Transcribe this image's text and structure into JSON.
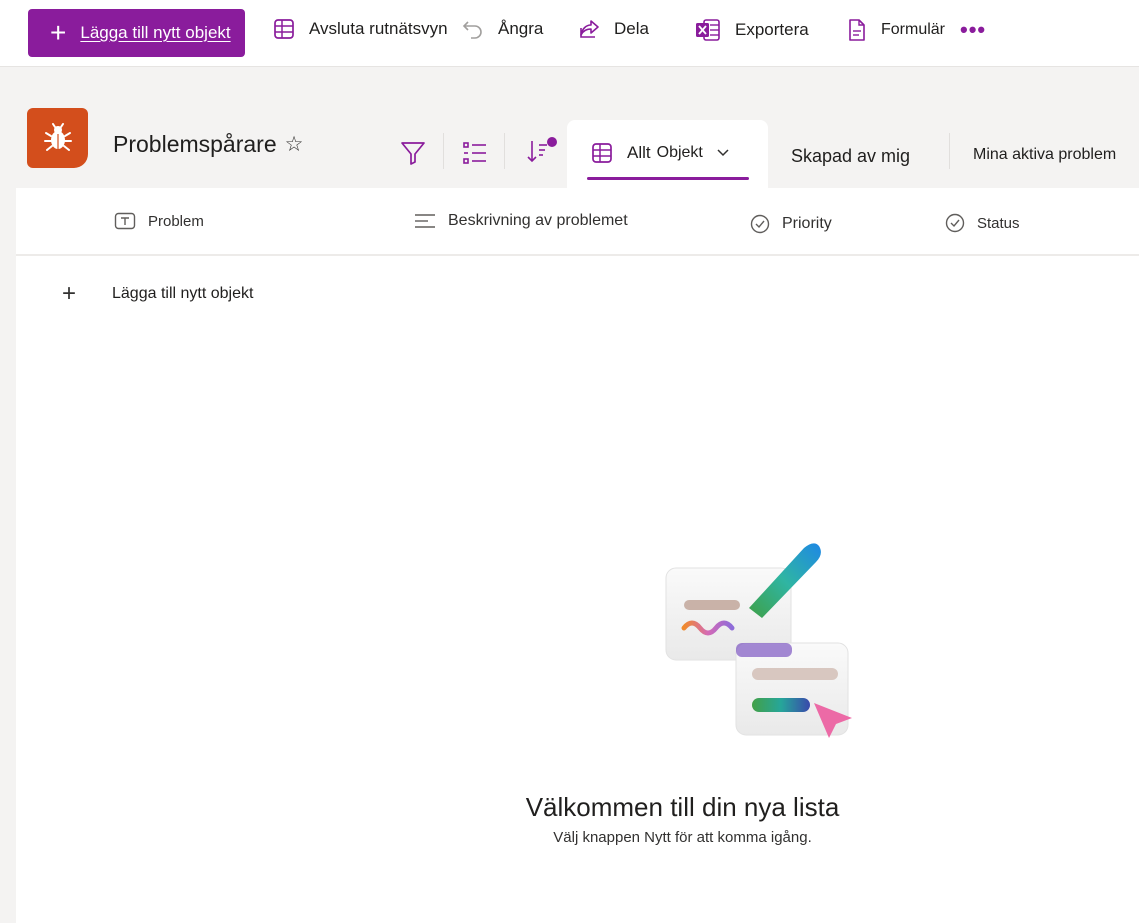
{
  "commandbar": {
    "new_label": "Lägga till nytt objekt",
    "grid_label": "Avsluta rutnätsvyn",
    "undo_label": "Ångra",
    "share_label": "Dela",
    "export_label": "Exportera",
    "forms_label": "Formulär",
    "more_label": "•••"
  },
  "header": {
    "list_title": "Problemspårare",
    "views": {
      "active_view_label": "Allt",
      "active_view_suffix": "Objekt",
      "created_by_me": "Skapad av mig",
      "my_active_problems": "Mina aktiva problem"
    }
  },
  "columns": [
    {
      "label": "Problem"
    },
    {
      "label": "Beskrivning av problemet"
    },
    {
      "label": "Priority"
    },
    {
      "label": "Status"
    }
  ],
  "list": {
    "add_item_label": "Lägga till nytt objekt"
  },
  "empty_state": {
    "title": "Välkommen till din nya lista",
    "subtitle": "Välj knappen Nytt för att komma igång."
  },
  "colors": {
    "accent": "#8a1c9c",
    "app_icon": "#d34e1c"
  }
}
